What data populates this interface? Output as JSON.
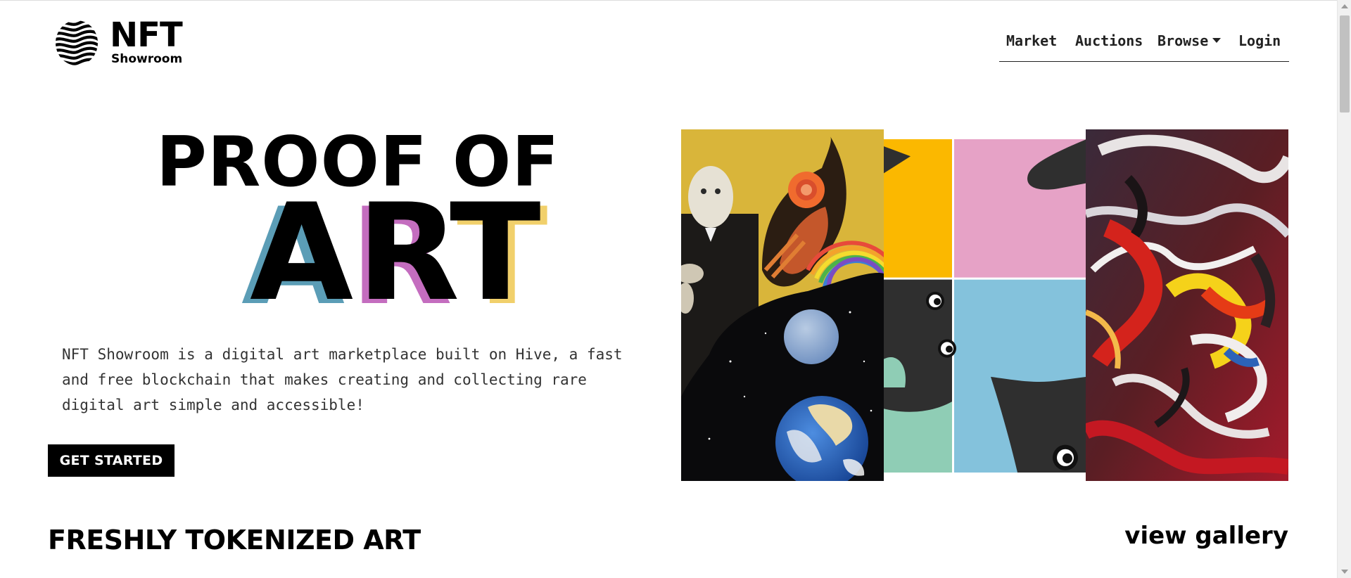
{
  "brand": {
    "name": "NFT",
    "subtitle": "Showroom"
  },
  "nav": {
    "items": [
      {
        "label": "Market"
      },
      {
        "label": "Auctions"
      },
      {
        "label": "Browse"
      },
      {
        "label": "Login"
      }
    ]
  },
  "hero": {
    "headline_top": "PROOF OF",
    "headline_letters": [
      "A",
      "R",
      "T"
    ],
    "description": "NFT Showroom is a digital art marketplace built on Hive, a fast and free blockchain that makes creating and collecting rare digital art simple and accessible!",
    "cta_label": "GET STARTED"
  },
  "gallery": {
    "section_title": "FRESHLY TOKENIZED ART",
    "view_link": "view gallery"
  },
  "colors": {
    "accent_blue": "#5b9db6",
    "accent_pink": "#c46dbf",
    "accent_yellow": "#f1d06b"
  },
  "icons": [
    "logo-sphere-icon",
    "chevron-down-icon",
    "scroll-up-icon",
    "scroll-down-icon"
  ]
}
